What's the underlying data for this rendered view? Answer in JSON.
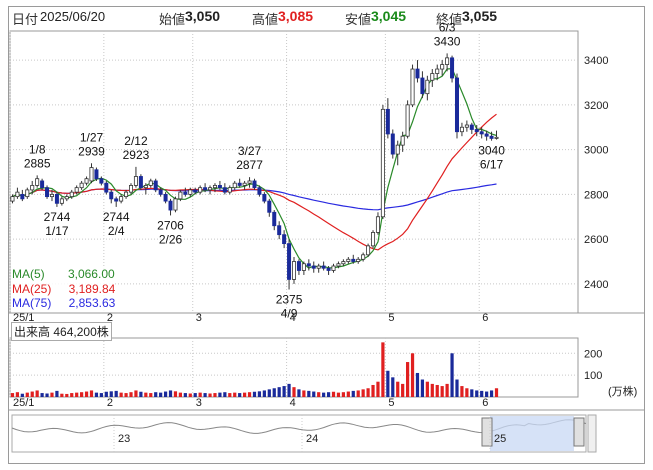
{
  "header": {
    "date_label": "日付",
    "date": "2025/06/20",
    "open_label": "始値",
    "open": "3,050",
    "high_label": "高値",
    "high": "3,085",
    "low_label": "安値",
    "low": "3,045",
    "close_label": "終値",
    "close": "3,055"
  },
  "legend": {
    "ma5_label": "MA(5)",
    "ma5_value": "3,066.00",
    "ma25_label": "MA(25)",
    "ma25_value": "3,189.84",
    "ma75_label": "MA(75)",
    "ma75_value": "2,853.63"
  },
  "volume_box": {
    "label": "出来高",
    "value": "464,200株"
  },
  "volume_unit": "(万株)",
  "colors": {
    "up": "#e02020",
    "down": "#1a2a9a",
    "ma5": "#2a8a2a",
    "ma25": "#e02020",
    "ma75": "#2a2ae0",
    "grid": "#c8c8c8"
  },
  "chart_data": {
    "type": "candlestick",
    "price_axis": {
      "ticks": [
        2400,
        2600,
        2800,
        3000,
        3200,
        3400
      ],
      "ylim": [
        2270,
        3530
      ]
    },
    "volume_axis": {
      "ticks": [
        100,
        200
      ],
      "ylim": [
        0,
        270
      ]
    },
    "x_axis": {
      "month_ticks": [
        {
          "label": "25/1",
          "index": 0
        },
        {
          "label": "2",
          "index": 19
        },
        {
          "label": "3",
          "index": 37
        },
        {
          "label": "4",
          "index": 56
        },
        {
          "label": "5",
          "index": 76
        },
        {
          "label": "6",
          "index": 95
        }
      ],
      "total_days": 115
    },
    "ohlc": [
      [
        2770,
        2800,
        2760,
        2790
      ],
      [
        2790,
        2830,
        2780,
        2810
      ],
      [
        2800,
        2820,
        2770,
        2780
      ],
      [
        2790,
        2830,
        2780,
        2820
      ],
      [
        2820,
        2860,
        2800,
        2840
      ],
      [
        2840,
        2885,
        2830,
        2870
      ],
      [
        2860,
        2870,
        2820,
        2830
      ],
      [
        2830,
        2840,
        2780,
        2790
      ],
      [
        2790,
        2820,
        2770,
        2800
      ],
      [
        2800,
        2810,
        2744,
        2760
      ],
      [
        2760,
        2790,
        2750,
        2780
      ],
      [
        2780,
        2800,
        2770,
        2790
      ],
      [
        2790,
        2820,
        2780,
        2810
      ],
      [
        2810,
        2840,
        2800,
        2830
      ],
      [
        2830,
        2860,
        2820,
        2850
      ],
      [
        2850,
        2880,
        2840,
        2870
      ],
      [
        2860,
        2939,
        2850,
        2920
      ],
      [
        2910,
        2920,
        2860,
        2870
      ],
      [
        2870,
        2880,
        2840,
        2850
      ],
      [
        2850,
        2860,
        2800,
        2810
      ],
      [
        2810,
        2820,
        2760,
        2780
      ],
      [
        2780,
        2790,
        2744,
        2770
      ],
      [
        2770,
        2800,
        2760,
        2790
      ],
      [
        2790,
        2820,
        2780,
        2810
      ],
      [
        2810,
        2850,
        2800,
        2840
      ],
      [
        2840,
        2923,
        2830,
        2880
      ],
      [
        2880,
        2890,
        2820,
        2830
      ],
      [
        2830,
        2850,
        2800,
        2840
      ],
      [
        2840,
        2870,
        2830,
        2860
      ],
      [
        2860,
        2870,
        2810,
        2820
      ],
      [
        2820,
        2830,
        2790,
        2800
      ],
      [
        2800,
        2810,
        2760,
        2770
      ],
      [
        2770,
        2780,
        2706,
        2730
      ],
      [
        2730,
        2790,
        2720,
        2780
      ],
      [
        2780,
        2820,
        2770,
        2810
      ],
      [
        2810,
        2830,
        2790,
        2800
      ],
      [
        2800,
        2830,
        2790,
        2820
      ],
      [
        2820,
        2830,
        2800,
        2810
      ],
      [
        2810,
        2840,
        2800,
        2830
      ],
      [
        2830,
        2850,
        2810,
        2820
      ],
      [
        2820,
        2840,
        2800,
        2830
      ],
      [
        2830,
        2850,
        2810,
        2840
      ],
      [
        2840,
        2860,
        2820,
        2830
      ],
      [
        2830,
        2850,
        2800,
        2810
      ],
      [
        2810,
        2840,
        2800,
        2830
      ],
      [
        2830,
        2860,
        2820,
        2850
      ],
      [
        2850,
        2870,
        2830,
        2840
      ],
      [
        2840,
        2860,
        2820,
        2850
      ],
      [
        2850,
        2877,
        2830,
        2860
      ],
      [
        2860,
        2870,
        2820,
        2830
      ],
      [
        2830,
        2840,
        2790,
        2800
      ],
      [
        2800,
        2810,
        2760,
        2770
      ],
      [
        2770,
        2780,
        2700,
        2720
      ],
      [
        2720,
        2730,
        2640,
        2660
      ],
      [
        2660,
        2680,
        2600,
        2620
      ],
      [
        2620,
        2640,
        2560,
        2580
      ],
      [
        2580,
        2600,
        2375,
        2420
      ],
      [
        2420,
        2520,
        2400,
        2500
      ],
      [
        2500,
        2510,
        2440,
        2460
      ],
      [
        2460,
        2500,
        2440,
        2490
      ],
      [
        2490,
        2510,
        2460,
        2480
      ],
      [
        2480,
        2500,
        2450,
        2470
      ],
      [
        2470,
        2490,
        2450,
        2480
      ],
      [
        2480,
        2500,
        2460,
        2470
      ],
      [
        2470,
        2480,
        2440,
        2460
      ],
      [
        2460,
        2490,
        2450,
        2480
      ],
      [
        2480,
        2500,
        2470,
        2490
      ],
      [
        2490,
        2510,
        2480,
        2500
      ],
      [
        2500,
        2520,
        2490,
        2510
      ],
      [
        2510,
        2530,
        2490,
        2500
      ],
      [
        2500,
        2520,
        2490,
        2510
      ],
      [
        2510,
        2540,
        2500,
        2530
      ],
      [
        2530,
        2580,
        2520,
        2570
      ],
      [
        2570,
        2640,
        2560,
        2630
      ],
      [
        2630,
        2720,
        2620,
        2700
      ],
      [
        2700,
        3200,
        2690,
        3180
      ],
      [
        3180,
        3230,
        3050,
        3070
      ],
      [
        3070,
        3090,
        2960,
        2980
      ],
      [
        2980,
        3040,
        2930,
        3020
      ],
      [
        3020,
        3080,
        2990,
        3060
      ],
      [
        3060,
        3220,
        3050,
        3200
      ],
      [
        3200,
        3380,
        3190,
        3360
      ],
      [
        3360,
        3400,
        3300,
        3320
      ],
      [
        3320,
        3350,
        3230,
        3250
      ],
      [
        3250,
        3330,
        3220,
        3310
      ],
      [
        3310,
        3360,
        3280,
        3340
      ],
      [
        3340,
        3380,
        3310,
        3360
      ],
      [
        3360,
        3400,
        3330,
        3380
      ],
      [
        3380,
        3430,
        3350,
        3410
      ],
      [
        3410,
        3420,
        3300,
        3320
      ],
      [
        3320,
        3340,
        3050,
        3080
      ],
      [
        3080,
        3120,
        3060,
        3100
      ],
      [
        3100,
        3130,
        3080,
        3110
      ],
      [
        3110,
        3120,
        3070,
        3090
      ],
      [
        3090,
        3110,
        3060,
        3080
      ],
      [
        3080,
        3100,
        3050,
        3070
      ],
      [
        3070,
        3085,
        3040,
        3060
      ],
      [
        3060,
        3080,
        3040,
        3050
      ],
      [
        3050,
        3085,
        3045,
        3055
      ]
    ],
    "volume": [
      18,
      22,
      15,
      20,
      25,
      30,
      18,
      16,
      20,
      28,
      15,
      14,
      18,
      20,
      22,
      25,
      30,
      20,
      18,
      24,
      26,
      28,
      20,
      18,
      22,
      30,
      24,
      20,
      18,
      22,
      20,
      25,
      30,
      26,
      20,
      18,
      16,
      18,
      20,
      18,
      16,
      18,
      20,
      22,
      18,
      20,
      18,
      20,
      22,
      24,
      26,
      30,
      35,
      40,
      45,
      50,
      60,
      45,
      35,
      30,
      28,
      25,
      22,
      20,
      22,
      24,
      20,
      22,
      25,
      28,
      30,
      35,
      40,
      55,
      70,
      250,
      120,
      90,
      70,
      60,
      160,
      200,
      110,
      80,
      70,
      60,
      55,
      50,
      60,
      200,
      80,
      50,
      40,
      35,
      30,
      28,
      25,
      30,
      40
    ],
    "annotations": [
      {
        "label": "1/8",
        "value": "2885",
        "index": 5,
        "position": "above"
      },
      {
        "label": "1/17",
        "value": "2744",
        "index": 9,
        "position": "below"
      },
      {
        "label": "1/27",
        "value": "2939",
        "index": 16,
        "position": "above"
      },
      {
        "label": "2/4",
        "value": "2744",
        "index": 21,
        "position": "below"
      },
      {
        "label": "2/12",
        "value": "2923",
        "index": 25,
        "position": "above"
      },
      {
        "label": "2/26",
        "value": "2706",
        "index": 32,
        "position": "below"
      },
      {
        "label": "3/27",
        "value": "2877",
        "index": 48,
        "position": "above"
      },
      {
        "label": "4/9",
        "value": "2375",
        "index": 56,
        "position": "below"
      },
      {
        "label": "6/3",
        "value": "3430",
        "index": 88,
        "position": "above"
      },
      {
        "label": "6/17",
        "value": "3040",
        "index": 97,
        "position": "below"
      }
    ],
    "ma25_end": 3189.84,
    "ma75_end": 2853.63,
    "overview": {
      "labels": [
        "23",
        "24",
        "25"
      ]
    }
  }
}
